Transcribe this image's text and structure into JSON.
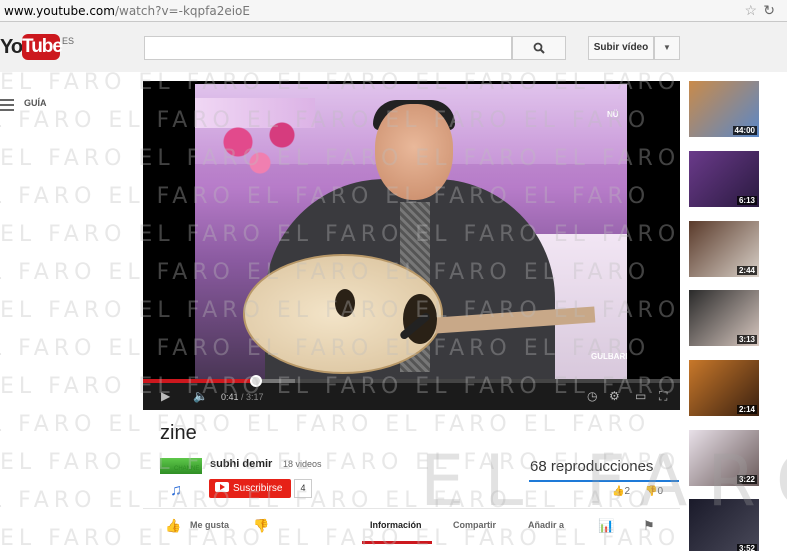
{
  "browser": {
    "url_host": "www.youtube.com",
    "url_path": "/watch?v=-kqpfa2eioE"
  },
  "header": {
    "logo_you": "You",
    "logo_tube": "Tube",
    "country": "ES",
    "search_placeholder": "",
    "upload_label": "Subir vídeo"
  },
  "guide": {
    "label": "GUÍA"
  },
  "player": {
    "current_time": "0:41",
    "duration": "/ 3:17",
    "progress_fraction": 0.21,
    "overlay_logo": "NÜ",
    "overlay_caption": "GULBARIN"
  },
  "video": {
    "title": "zine",
    "channel_name": "subhi demir",
    "video_count": "18 videos",
    "channel_thumb_text": "CHANNE",
    "subscribe_label": "Suscribirse",
    "subscriber_count": "4",
    "views": "68 reproducciones",
    "likes": "2",
    "dislikes": "0"
  },
  "actions": {
    "like_label": "Me gusta",
    "info_label": "Información",
    "share_label": "Compartir",
    "add_label": "Añadir a"
  },
  "sidebar": [
    {
      "duration": "44:00",
      "colors": [
        "#c98a4a",
        "#5a88c8"
      ]
    },
    {
      "duration": "6:13",
      "colors": [
        "#6a3a8a",
        "#2a1a40"
      ]
    },
    {
      "duration": "2:44",
      "colors": [
        "#5a3a2a",
        "#d8d0c8"
      ]
    },
    {
      "duration": "3:13",
      "colors": [
        "#2a2a2a",
        "#d8c8c0"
      ]
    },
    {
      "duration": "2:14",
      "colors": [
        "#c8782a",
        "#3a2010"
      ]
    },
    {
      "duration": "3:22",
      "colors": [
        "#e8e0e8",
        "#6a5a5a"
      ]
    },
    {
      "duration": "3:52",
      "colors": [
        "#1a1a2a",
        "#4a4a5a"
      ]
    }
  ],
  "watermark": "EL FARO"
}
